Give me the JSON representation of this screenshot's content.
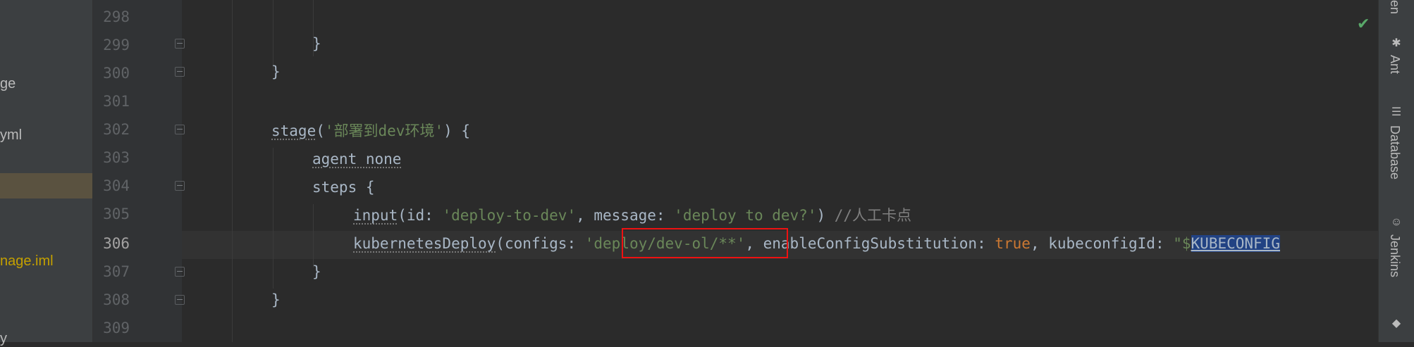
{
  "project_panel": {
    "items": [
      {
        "label": "ge",
        "modified": false
      },
      {
        "label": "yml",
        "modified": false
      },
      {
        "label": "nage.iml",
        "modified": true
      },
      {
        "label": "y",
        "modified": false
      }
    ]
  },
  "editor": {
    "lines": [
      {
        "num": "298",
        "text": ""
      },
      {
        "num": "299",
        "text": "}"
      },
      {
        "num": "300",
        "text": "}"
      },
      {
        "num": "301",
        "text": ""
      },
      {
        "num": "302",
        "method": "stage",
        "open": "(",
        "str": "'部署到dev环境'",
        "close": ") {"
      },
      {
        "num": "303",
        "text": "agent none"
      },
      {
        "num": "304",
        "text": "steps {"
      },
      {
        "num": "305",
        "method": "input",
        "p1": "(id: ",
        "s1": "'deploy-to-dev'",
        "p2": ", message: ",
        "s2": "'deploy to dev?'",
        "p3": ") ",
        "comment": "//人工卡点"
      },
      {
        "num": "306",
        "method": "kubernetesDeploy",
        "p1": "(configs: ",
        "q1": "'",
        "s1": "deploy/dev-ol/**",
        "q2": "'",
        "p2": ", enableConfigSubstitution: ",
        "kw": "true",
        "p3": ", kubeconfigId: ",
        "s2": "\"$",
        "sel": "KUBECONFIG"
      },
      {
        "num": "307",
        "text": "}"
      },
      {
        "num": "308",
        "text": "}"
      },
      {
        "num": "309",
        "text": ""
      }
    ],
    "current_line": "306"
  },
  "right_tools": {
    "ant": "Ant",
    "database": "Database",
    "jenkins": "Jenkins",
    "top_partial": "en"
  },
  "status": {
    "inspection_icon": "check-icon",
    "ok_color": "#59a869"
  }
}
